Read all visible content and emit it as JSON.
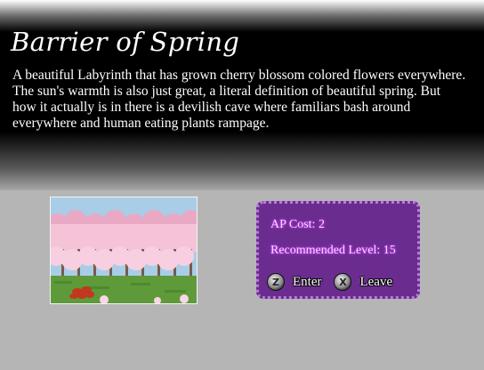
{
  "location": {
    "title": "Barrier of Spring",
    "description": "A beautiful Labyrinth that has grown cherry blossom colored flowers everywhere. The sun's warmth is also just great, a literal definition of beautiful spring. But how it actually is in there is a devilish cave where familiars bash around everywhere and human eating plants rampage."
  },
  "info": {
    "ap_cost": "AP Cost: 2",
    "recommended_level": "Recommended Level: 15"
  },
  "buttons": {
    "enter": {
      "key": "Z",
      "label": "Enter"
    },
    "leave": {
      "key": "X",
      "label": "Leave"
    }
  },
  "colors": {
    "panel": "#6a2c8f",
    "panel_border": "#b77bd6",
    "blossom": "#f2b6cf",
    "grass": "#5f9a3a",
    "sky": "#a9cde6"
  }
}
